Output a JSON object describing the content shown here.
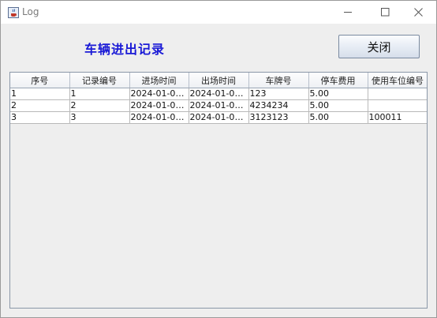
{
  "window": {
    "title": "Log"
  },
  "heading": "车辆进出记录",
  "close_button_label": "关闭",
  "table": {
    "columns": [
      "序号",
      "记录编号",
      "进场时间",
      "出场时间",
      "车牌号",
      "停车费用",
      "使用车位编号"
    ],
    "rows": [
      [
        "1",
        "1",
        "2024-01-08...",
        "2024-01-08...",
        "123",
        "5.00",
        ""
      ],
      [
        "2",
        "2",
        "2024-01-08...",
        "2024-01-08...",
        "4234234",
        "5.00",
        ""
      ],
      [
        "3",
        "3",
        "2024-01-08...",
        "2024-01-08...",
        "3123123",
        "5.00",
        "100011"
      ]
    ]
  },
  "colors": {
    "heading": "#1a1ad6",
    "window_bg": "#eeeeee",
    "titlebar_bg": "#ffffff"
  },
  "icons": {
    "app": "java-cup-icon",
    "minimize": "minimize-icon",
    "maximize": "maximize-icon",
    "close": "close-icon"
  }
}
